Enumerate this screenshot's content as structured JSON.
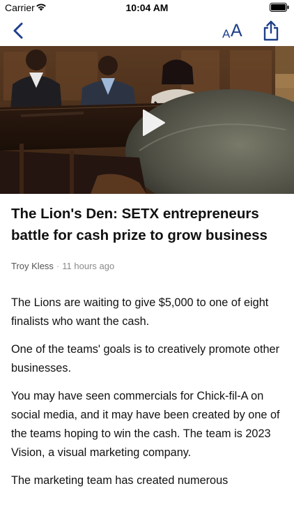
{
  "status_bar": {
    "carrier": "Carrier",
    "time": "10:04 AM"
  },
  "nav": {
    "back_icon": "chevron-left-icon",
    "text_size_small": "A",
    "text_size_large": "A",
    "share_icon": "share-icon",
    "accent_color": "#1e3f8a"
  },
  "video": {
    "play_icon": "play-icon"
  },
  "article": {
    "title": "The Lion's Den: SETX entrepreneurs battle for cash prize to grow business",
    "author": "Troy Kless",
    "separator": "·",
    "timestamp": "11 hours ago",
    "paragraphs": [
      "The Lions are waiting to give $5,000 to one of eight finalists who want the cash.",
      "One of the teams' goals is to creatively promote other businesses.",
      "You may have seen commercials for Chick-fil-A on social media, and it may have been created by one of the teams hoping to win the cash. The team is 2023 Vision, a visual marketing company.",
      "The marketing team has created numerous"
    ]
  }
}
